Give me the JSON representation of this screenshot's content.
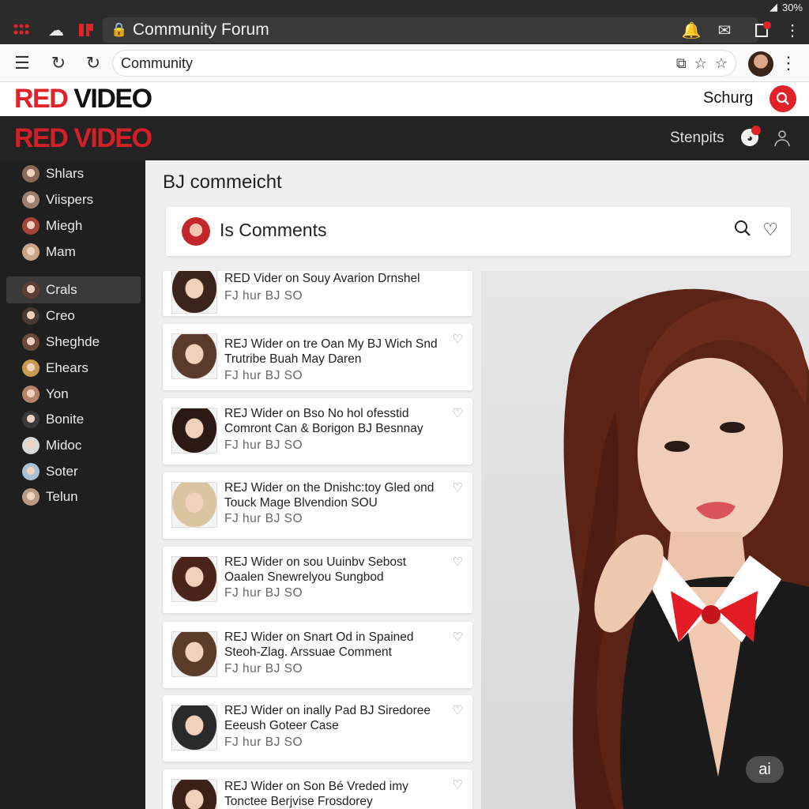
{
  "status_bar": {
    "battery": "30%",
    "signal": "◢"
  },
  "tab_bar": {
    "title": "Community Forum"
  },
  "toolbar": {
    "url": "Community"
  },
  "site": {
    "logo_red": "RED",
    "logo_black": " VIDEO",
    "search_label": "Schurg",
    "dark_logo": "RED VIDEO",
    "settings_label": "Stenpits"
  },
  "sidebar": {
    "items": [
      {
        "label": "Shlars",
        "color": "#8a6a58"
      },
      {
        "label": "Viispers",
        "color": "#9c7f6f"
      },
      {
        "label": "Miegh",
        "color": "#a4453a"
      },
      {
        "label": "Mam",
        "color": "#caa488"
      },
      {
        "label": "Crals",
        "color": "#5a4034"
      },
      {
        "label": "Creo",
        "color": "#4b3a33"
      },
      {
        "label": "Sheghde",
        "color": "#6b4a3d"
      },
      {
        "label": "Ehears",
        "color": "#c79c4c"
      },
      {
        "label": "Yon",
        "color": "#b4836b"
      },
      {
        "label": "Bonite",
        "color": "#3a3a3a"
      },
      {
        "label": "Midoc",
        "color": "#d9d9d9"
      },
      {
        "label": "Soter",
        "color": "#a9c2d6"
      },
      {
        "label": "Telun",
        "color": "#b89a86"
      }
    ]
  },
  "main": {
    "page_title": "BJ commeicht",
    "comments_card_title": "Is Comments",
    "posts": [
      {
        "title": "RED Vider on Souy Avarion Drnshel",
        "meta": "FJ hur BJ  SO"
      },
      {
        "title": "REJ Wider on tre Oan My BJ Wich Snd Trutribe Buah May Daren",
        "meta": "FJ hur BJ  SO"
      },
      {
        "title": "REJ Wider on Bso No hol ofesstid Comront Can & Borigon BJ Besnnay",
        "meta": "FJ hur BJ  SO"
      },
      {
        "title": "REJ Wider on the Dnishc:toy Gled ond Touck Mage Blvendion SOU",
        "meta": "FJ hur BJ  SO"
      },
      {
        "title": "REJ Wider on sou Uuinbv Sebost Oaalen Snewrelyou Sungbod",
        "meta": "FJ hur BJ  SO"
      },
      {
        "title": "REJ Wider on Snart Od in Spained Steoh-Zlag. Arssuae Comment",
        "meta": "FJ hur BJ  SO"
      },
      {
        "title": "REJ Wider on inally Pad BJ Siredoree Eeeush Goteer Case",
        "meta": "FJ hur BJ  SO"
      },
      {
        "title": "REJ Wider on Son Bé Vreded imy Tonctee Berjvise Frosdorey",
        "meta": ""
      }
    ],
    "ai_badge": "ai"
  }
}
